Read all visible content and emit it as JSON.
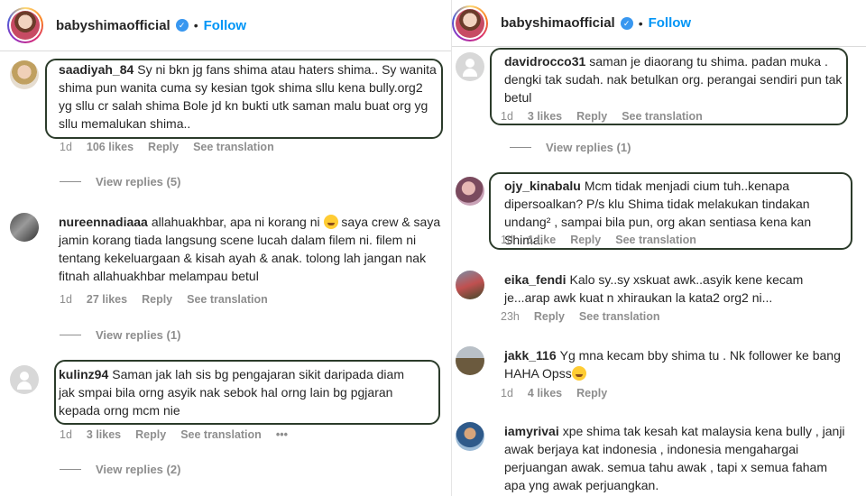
{
  "left": {
    "header": {
      "username": "babyshimaofficial",
      "separator": "•",
      "follow": "Follow"
    },
    "comments": [
      {
        "user": "saadiyah_84",
        "text": "Sy ni bkn jg fans shima atau haters shima.. Sy wanita shima pun wanita cuma sy kesian tgok shima sllu kena bully.org2 yg sllu cr salah shima Bole jd kn bukti utk saman malu buat org yg sllu memalukan shima..",
        "time": "1d",
        "likes": "106 likes",
        "reply": "Reply",
        "translate": "See translation",
        "view_replies": "View replies (5)"
      },
      {
        "user": "nureennadiaaa",
        "text_before": "allahuakhbar, apa ni korang ni ",
        "text_after": " saya crew & saya jamin korang tiada langsung scene lucah dalam filem ni. filem ni tentang kekeluargaan & kisah ayah & anak. tolong lah jangan nak fitnah allahuakhbar melampau betul",
        "emoji": "crying-face",
        "time": "1d",
        "likes": "27 likes",
        "reply": "Reply",
        "translate": "See translation",
        "view_replies": "View replies (1)"
      },
      {
        "user": "kulinz94",
        "text": "Saman jak lah sis bg pengajaran sikit daripada diam jak smpai bila orng asyik nak sebok hal orng lain bg pgjaran kepada orng mcm nie",
        "time": "1d",
        "likes": "3 likes",
        "reply": "Reply",
        "translate": "See translation",
        "more": "•••",
        "view_replies": "View replies (2)"
      }
    ]
  },
  "right": {
    "header": {
      "username": "babyshimaofficial",
      "separator": "•",
      "follow": "Follow"
    },
    "comments": [
      {
        "user": "davidrocco31",
        "text": "saman je diaorang tu shima. padan muka . dengki tak sudah. nak betulkan org. perangai sendiri pun tak betul",
        "time": "1d",
        "likes": "3 likes",
        "reply": "Reply",
        "translate": "See translation",
        "view_replies": "View replies (1)"
      },
      {
        "user": "ojy_kinabalu",
        "text": "Mcm tidak menjadi cium tuh..kenapa dipersoalkan? P/s klu Shima tidak melakukan tindakan undang² , sampai bila pun, org akan sentiasa kena kan Shima.",
        "time": "1d",
        "likes": "1 like",
        "reply": "Reply",
        "translate": "See translation"
      },
      {
        "user": "eika_fendi",
        "text": "Kalo sy..sy xskuat awk..asyik kene kecam je...arap awk kuat n xhiraukan la kata2 org2 ni...",
        "time": "23h",
        "reply": "Reply",
        "translate": "See translation"
      },
      {
        "user": "jakk_116",
        "text": "Yg mna kecam bby shima tu . Nk follower ke bang HAHA Opss",
        "emoji": "laughing-face",
        "time": "1d",
        "likes": "4 likes",
        "reply": "Reply"
      },
      {
        "user": "iamyrivai",
        "text": "xpe shima tak kesah kat malaysia kena bully , janji awak berjaya kat indonesia , indonesia mengahargai perjuangan awak. semua tahu awak , tapi x semua faham apa yng awak perjuangkan."
      }
    ]
  },
  "colors": {
    "follow": "#0095f6",
    "meta": "#8e8e8e",
    "highlight": "#2b3b2a",
    "verified": "#3897f0"
  }
}
